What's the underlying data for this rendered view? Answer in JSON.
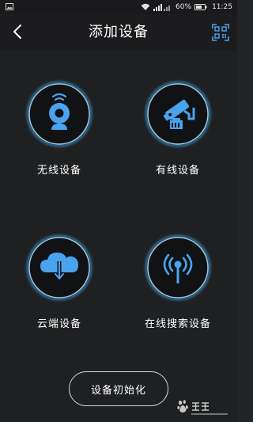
{
  "status_bar": {
    "battery": "60%",
    "time": "11:25"
  },
  "header": {
    "title": "添加设备"
  },
  "options": [
    {
      "label": "无线设备",
      "icon": "webcam-icon"
    },
    {
      "label": "有线设备",
      "icon": "security-camera-icon"
    },
    {
      "label": "云端设备",
      "icon": "cloud-download-icon"
    },
    {
      "label": "在线搜索设备",
      "icon": "broadcast-antenna-icon"
    }
  ],
  "footer": {
    "init_label": "设备初始化"
  },
  "colors": {
    "background": "#1f2022",
    "accent_blue": "#4aa3ee",
    "ring_glow": "#3fa0d8",
    "text": "#ffffff"
  }
}
